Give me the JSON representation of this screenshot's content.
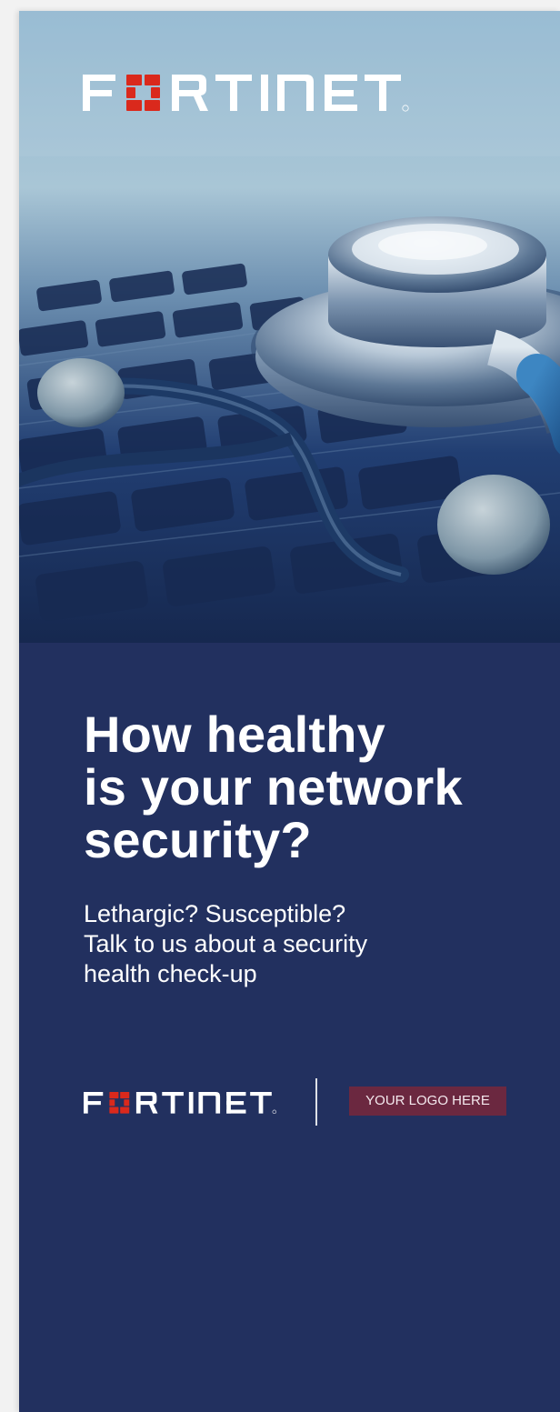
{
  "brand": {
    "name": "FORTINET",
    "logo_colors": {
      "text": "#ffffff",
      "accent": "#da291c"
    },
    "registered_mark": "®"
  },
  "photo": {
    "icon": "stethoscope-on-keyboard-photo"
  },
  "headline": {
    "lines": [
      "How healthy",
      "is your network",
      "security?"
    ]
  },
  "subtext": {
    "lines": [
      "Lethargic? Susceptible?",
      "Talk to us about a security",
      "health check-up"
    ]
  },
  "footer": {
    "partner_logo_text": "YOUR LOGO HERE",
    "partner_logo_bg": "#6b2840"
  },
  "colors": {
    "panel_bg": "#22305f",
    "text": "#ffffff"
  }
}
